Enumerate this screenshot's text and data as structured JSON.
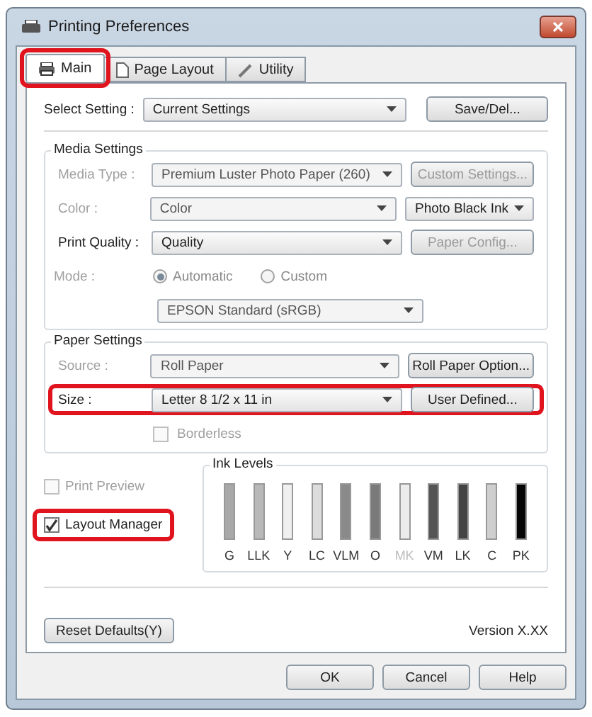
{
  "window": {
    "title": "Printing Preferences"
  },
  "tabs": [
    {
      "label": "Main",
      "selected": true,
      "highlighted": true
    },
    {
      "label": "Page Layout",
      "selected": false,
      "highlighted": false
    },
    {
      "label": "Utility",
      "selected": false,
      "highlighted": false
    }
  ],
  "select_setting": {
    "label": "Select Setting :",
    "value": "Current Settings",
    "button": "Save/Del..."
  },
  "media_settings": {
    "title": "Media Settings",
    "rows": [
      {
        "kind": "dropdown",
        "label": "Media Type :",
        "value": "Premium Luster Photo Paper (260)",
        "disabled": true,
        "button": {
          "kind": "button",
          "label": "Custom Settings...",
          "disabled": true
        }
      },
      {
        "kind": "dropdown",
        "label": "Color :",
        "value": "Color",
        "disabled": true,
        "button": {
          "kind": "dropdown",
          "label": "Photo Black Ink",
          "disabled": false
        }
      },
      {
        "kind": "dropdown",
        "label": "Print Quality :",
        "value": "Quality",
        "disabled": false,
        "button": {
          "kind": "button",
          "label": "Paper Config...",
          "disabled": true
        }
      },
      {
        "kind": "radio",
        "label": "Mode :",
        "options": [
          {
            "label": "Automatic",
            "selected": true
          },
          {
            "label": "Custom",
            "selected": false
          }
        ]
      },
      {
        "kind": "dropdown",
        "value": "EPSON Standard (sRGB)",
        "disabled": true
      }
    ]
  },
  "paper_settings": {
    "title": "Paper Settings",
    "rows": [
      {
        "kind": "dropdown",
        "label": "Source :",
        "value": "Roll Paper",
        "disabled": true,
        "highlighted": false,
        "button": {
          "kind": "button",
          "label": "Roll Paper Option...",
          "disabled": false
        }
      },
      {
        "kind": "dropdown",
        "label": "Size :",
        "value": "Letter 8 1/2 x 11 in",
        "disabled": false,
        "highlighted": true,
        "button": {
          "kind": "button",
          "label": "User Defined...",
          "disabled": false
        }
      },
      {
        "kind": "checkbox",
        "label": "Borderless",
        "checked": false,
        "disabled": true
      }
    ]
  },
  "options": [
    {
      "label": "Print Preview",
      "checked": false,
      "disabled": true,
      "highlighted": false
    },
    {
      "label": "Layout Manager",
      "checked": true,
      "disabled": false,
      "highlighted": true
    }
  ],
  "ink_levels": {
    "title": "Ink Levels",
    "inks": [
      {
        "name": "G",
        "color": "#a8a8a8",
        "level": 1,
        "dim": false
      },
      {
        "name": "LLK",
        "color": "#b8b8b8",
        "level": 1,
        "dim": false
      },
      {
        "name": "Y",
        "color": "#f0f0f0",
        "level": 1,
        "dim": false
      },
      {
        "name": "LC",
        "color": "#dcdcdc",
        "level": 1,
        "dim": false
      },
      {
        "name": "VLM",
        "color": "#8a8a8a",
        "level": 1,
        "dim": false
      },
      {
        "name": "O",
        "color": "#7a7a7a",
        "level": 1,
        "dim": false
      },
      {
        "name": "MK",
        "color": "#ececec",
        "level": 1,
        "dim": true
      },
      {
        "name": "VM",
        "color": "#555555",
        "level": 1,
        "dim": false
      },
      {
        "name": "LK",
        "color": "#444444",
        "level": 1,
        "dim": false
      },
      {
        "name": "C",
        "color": "#cfcfcf",
        "level": 1,
        "dim": false
      },
      {
        "name": "PK",
        "color": "#050505",
        "level": 1,
        "dim": false
      }
    ]
  },
  "reset_button": "Reset Defaults(Y)",
  "version": "Version X.XX",
  "buttons": [
    "OK",
    "Cancel",
    "Help"
  ]
}
